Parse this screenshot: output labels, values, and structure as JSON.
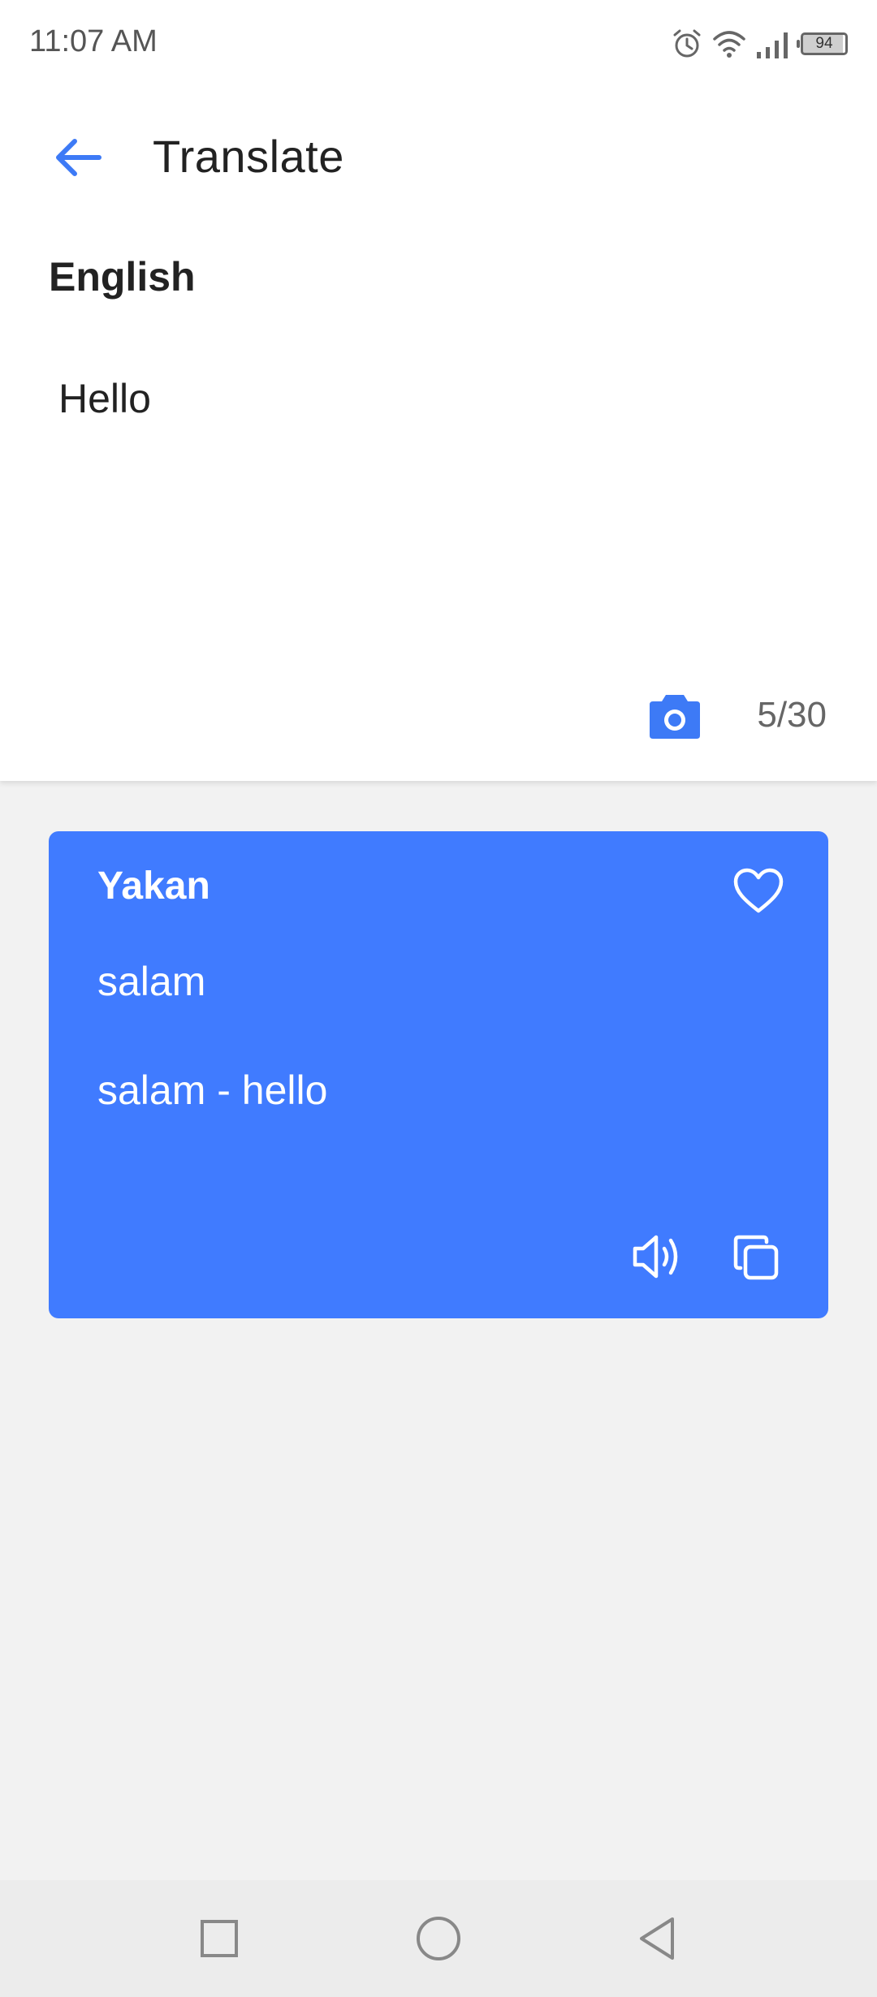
{
  "status_bar": {
    "time": "11:07 AM",
    "battery_level": "94",
    "icons": [
      "alarm-icon",
      "wifi-icon",
      "signal-icon",
      "battery-icon"
    ]
  },
  "header": {
    "title": "Translate",
    "back_icon": "arrow-left-icon"
  },
  "source": {
    "language": "English",
    "text": "Hello",
    "char_count": "5/30",
    "camera_icon": "camera-icon"
  },
  "result": {
    "language": "Yakan",
    "translation": "salam",
    "definition": "salam - hello",
    "icons": [
      "heart-icon",
      "speaker-icon",
      "copy-icon"
    ]
  },
  "nav": {
    "icons": [
      "recents-square-icon",
      "home-circle-icon",
      "back-triangle-icon"
    ]
  },
  "colors": {
    "accent": "#407bff",
    "background": "#f2f2f2",
    "surface": "#ffffff"
  }
}
